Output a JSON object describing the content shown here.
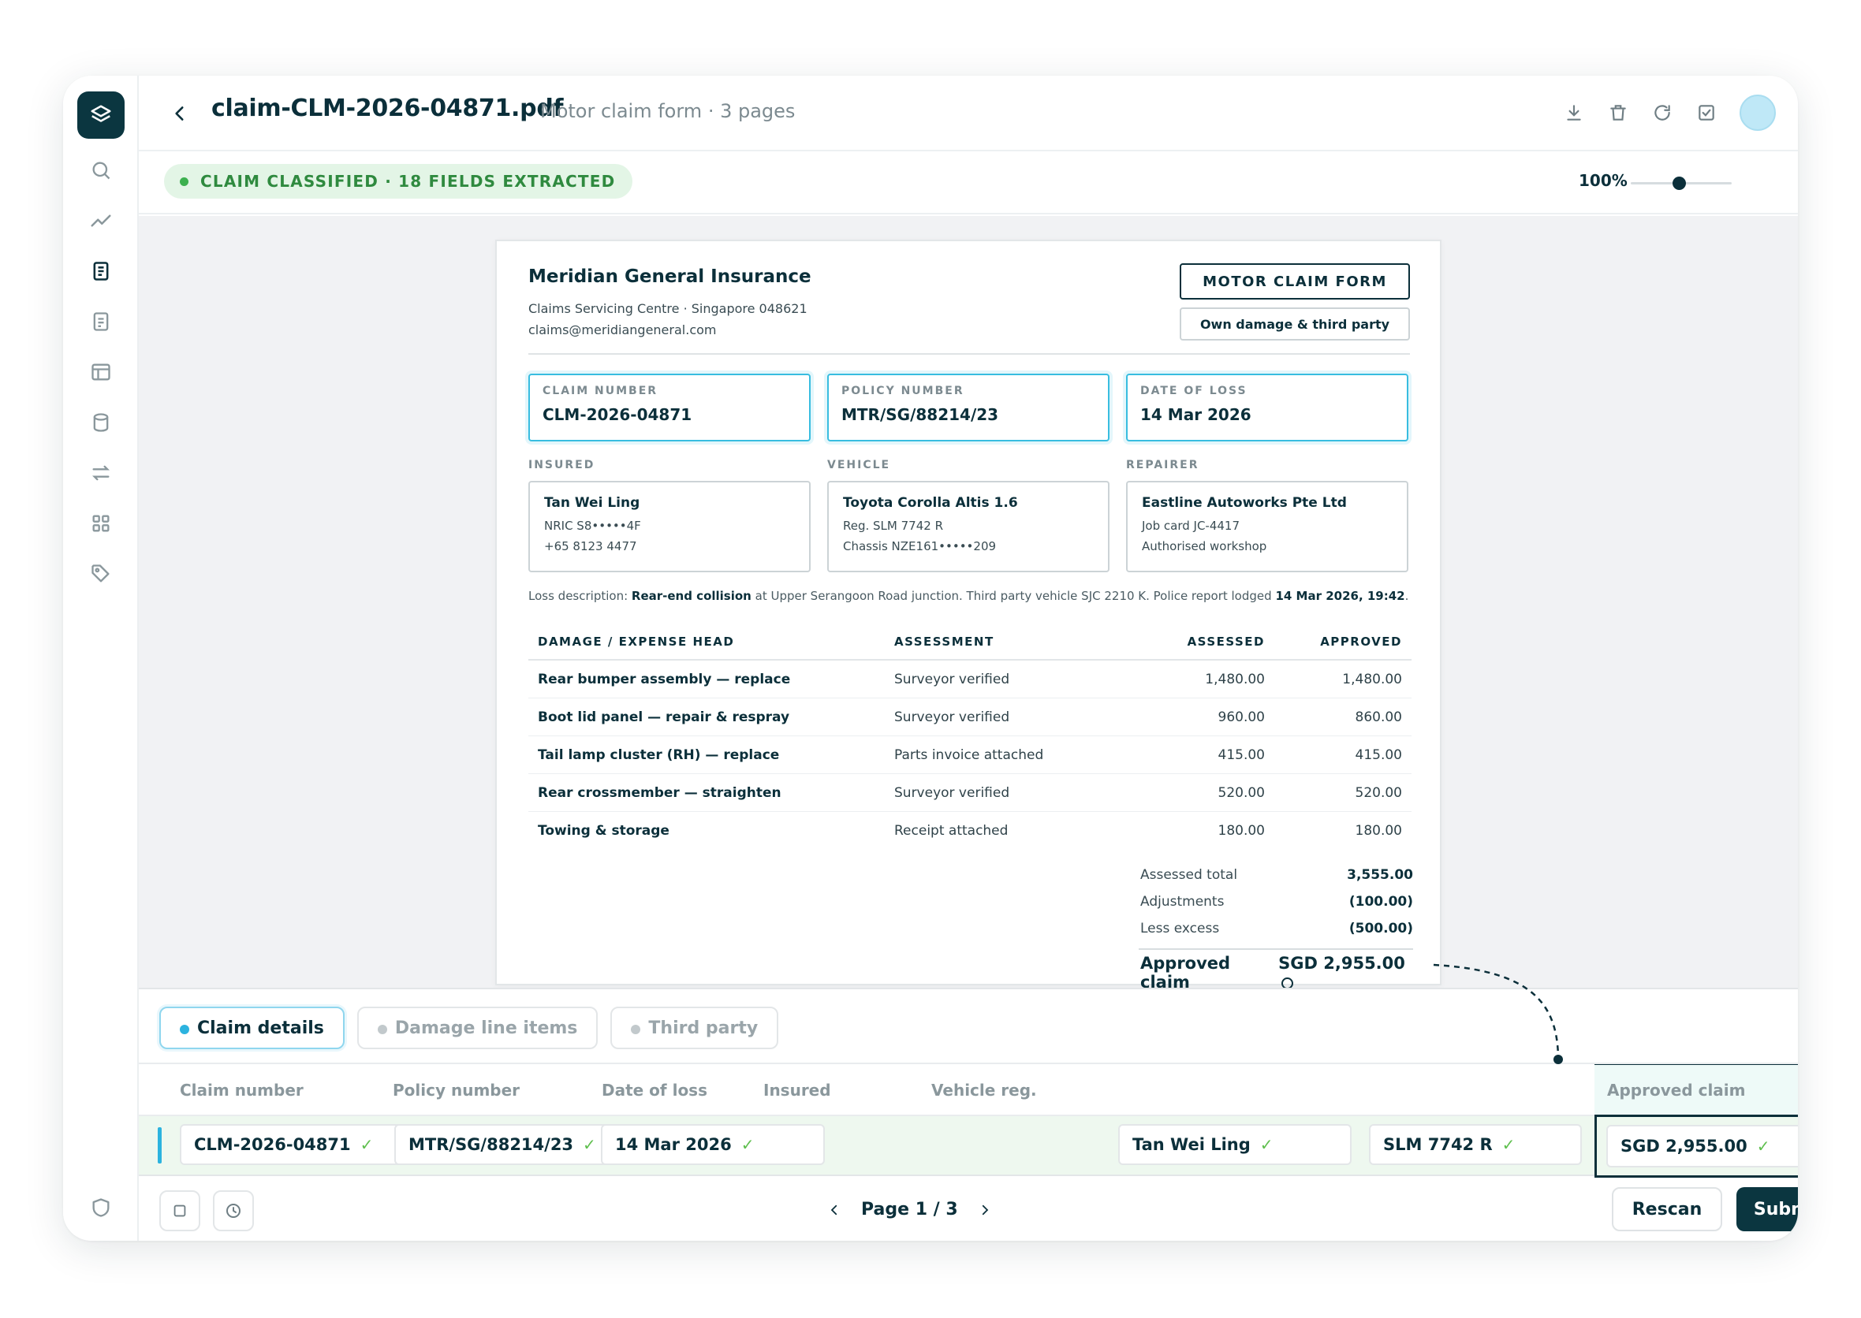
{
  "colors": {
    "brand": "#0b3640",
    "accent": "#2cb3df",
    "success": "#3cb04f",
    "highlight_border": "#38bde0"
  },
  "rail": {
    "logo_icon": "layers-icon",
    "items": [
      "search-icon",
      "trend-icon",
      "document-icon",
      "report-icon",
      "layout-icon",
      "database-icon",
      "transfer-icon",
      "apps-icon",
      "tag-icon"
    ],
    "bottom_icon": "shield-icon"
  },
  "header": {
    "title": "claim-CLM-2026-04871.pdf",
    "subtitle": "Motor claim form · 3 pages",
    "actions": [
      "download-icon",
      "trash-icon",
      "refresh-icon",
      "checkbox-icon"
    ]
  },
  "status": {
    "text": "CLAIM CLASSIFIED · 18 FIELDS EXTRACTED",
    "zoom": "100%",
    "zoom_level": 0.5
  },
  "document": {
    "insurer": "Meridian General Insurance",
    "address1": "Claims Servicing Centre · Singapore 048621",
    "address2": "claims@meridiangeneral.com",
    "form_type": "MOTOR CLAIM FORM",
    "form_subtype": "Own damage & third party",
    "key_fields": [
      {
        "label": "CLAIM NUMBER",
        "value": "CLM-2026-04871"
      },
      {
        "label": "POLICY NUMBER",
        "value": "MTR/SG/88214/23"
      },
      {
        "label": "DATE OF LOSS",
        "value": "14 Mar 2026"
      }
    ],
    "info": [
      {
        "label": "INSURED",
        "line1": "Tan Wei Ling",
        "line2": "NRIC S8•••••4F",
        "line3": "+65 8123 4477"
      },
      {
        "label": "VEHICLE",
        "line1": "Toyota Corolla Altis 1.6",
        "line2": "Reg. SLM 7742 R",
        "line3": "Chassis NZE161•••••209"
      },
      {
        "label": "REPAIRER",
        "line1": "Eastline Autoworks Pte Ltd",
        "line2": "Job card JC-4417",
        "line3": "Authorised workshop"
      }
    ],
    "loss": {
      "prefix": "Loss description: ",
      "bold1": "Rear-end collision",
      "middle": " at Upper Serangoon Road junction. Third party vehicle SJC 2210 K. Police report lodged ",
      "bold2": "14 Mar 2026, 19:42",
      "suffix": "."
    },
    "table": {
      "headers": [
        "DAMAGE / EXPENSE HEAD",
        "ASSESSMENT",
        "ASSESSED",
        "APPROVED"
      ],
      "rows": [
        [
          "Rear bumper assembly — replace",
          "Surveyor verified",
          "1,480.00",
          "1,480.00"
        ],
        [
          "Boot lid panel — repair & respray",
          "Surveyor verified",
          "960.00",
          "860.00"
        ],
        [
          "Tail lamp cluster (RH) — replace",
          "Parts invoice attached",
          "415.00",
          "415.00"
        ],
        [
          "Rear crossmember — straighten",
          "Surveyor verified",
          "520.00",
          "520.00"
        ],
        [
          "Towing & storage",
          "Receipt attached",
          "180.00",
          "180.00"
        ]
      ]
    },
    "totals": [
      {
        "label": "Assessed total",
        "value": "3,555.00"
      },
      {
        "label": "Adjustments",
        "value": "(100.00)"
      },
      {
        "label": "Less excess",
        "value": "(500.00)"
      }
    ],
    "approved_label": "Approved claim",
    "approved_value": "SGD 2,955.00"
  },
  "panel": {
    "tabs": [
      "Claim details",
      "Damage line items",
      "Third party"
    ],
    "columns": [
      "Claim number",
      "Policy number",
      "Date of loss",
      "Insured",
      "Vehicle reg.",
      "Approved claim"
    ],
    "values": [
      "CLM-2026-04871",
      "MTR/SG/88214/23",
      "14 Mar 2026",
      "Tan Wei Ling",
      "SLM 7742 R",
      "SGD 2,955.00"
    ],
    "check": "✓",
    "page_label": "Page 1 / 3",
    "rescan": "Rescan",
    "submit": "Submit"
  }
}
